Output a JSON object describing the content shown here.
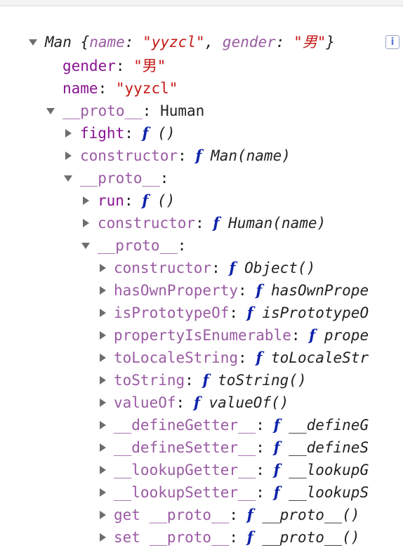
{
  "summary": {
    "class_name": "Man",
    "open": " {",
    "k1": "name",
    "v1": "\"yyzcl\"",
    "sep": ", ",
    "k2": "gender",
    "v2": "\"男\"",
    "close": "}"
  },
  "props": {
    "gender_key": "gender",
    "gender_val": "\"男\"",
    "name_key": "name",
    "name_val": "\"yyzcl\""
  },
  "proto1": {
    "key": "__proto__",
    "value": "Human"
  },
  "fight": {
    "key": "fight",
    "sig": "()"
  },
  "ctor_man": {
    "key": "constructor",
    "sig": "Man(name)"
  },
  "proto2": {
    "key": "__proto__"
  },
  "run": {
    "key": "run",
    "sig": "()"
  },
  "ctor_human": {
    "key": "constructor",
    "sig": "Human(name)"
  },
  "proto3": {
    "key": "__proto__"
  },
  "object_proto": [
    {
      "key": "constructor",
      "sig": "Object()"
    },
    {
      "key": "hasOwnProperty",
      "sig": "hasOwnPrope"
    },
    {
      "key": "isPrototypeOf",
      "sig": "isPrototypeO"
    },
    {
      "key": "propertyIsEnumerable",
      "sig": "prope"
    },
    {
      "key": "toLocaleString",
      "sig": "toLocaleStr"
    },
    {
      "key": "toString",
      "sig": "toString()"
    },
    {
      "key": "valueOf",
      "sig": "valueOf()"
    },
    {
      "key": "__defineGetter__",
      "sig": "__defineG"
    },
    {
      "key": "__defineSetter__",
      "sig": "__defineS"
    },
    {
      "key": "__lookupGetter__",
      "sig": "__lookupG"
    },
    {
      "key": "__lookupSetter__",
      "sig": "__lookupS"
    },
    {
      "key": "get __proto__",
      "sig": "__proto__()"
    },
    {
      "key": "set __proto__",
      "sig": "__proto__()"
    }
  ],
  "labels": {
    "colon": ": ",
    "f": "f",
    "info": "i"
  }
}
